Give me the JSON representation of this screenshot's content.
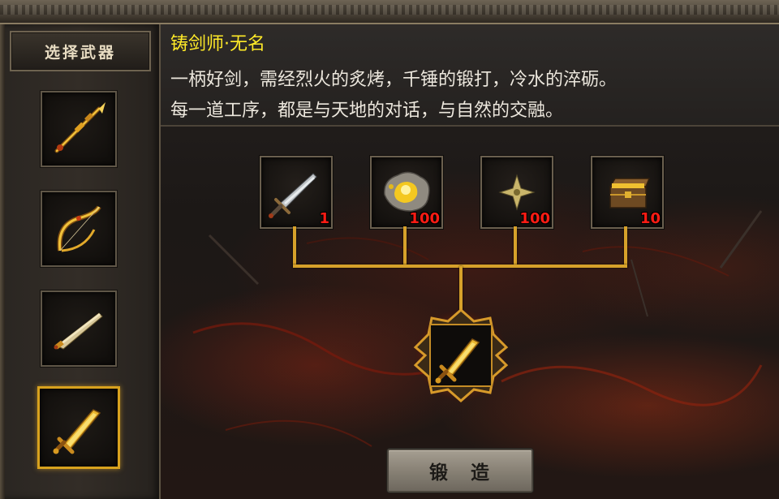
{
  "sidebar": {
    "title": "选择武器",
    "weapons": [
      {
        "icon": "golden-spear-icon",
        "selected": false
      },
      {
        "icon": "golden-bow-icon",
        "selected": false
      },
      {
        "icon": "golden-blade-icon",
        "selected": false
      },
      {
        "icon": "golden-greatsword-icon",
        "selected": true
      }
    ]
  },
  "description": {
    "title": "铸剑师·无名",
    "line1": "一柄好剑，需经烈火的炙烤，千锤的锻打，冷水的淬砺。",
    "line2": "每一道工序，都是与天地的对话，与自然的交融。"
  },
  "materials": [
    {
      "icon": "sword-icon",
      "count": "1"
    },
    {
      "icon": "gold-ore-icon",
      "count": "100"
    },
    {
      "icon": "shuriken-star-icon",
      "count": "100"
    },
    {
      "icon": "treasure-chest-icon",
      "count": "10"
    }
  ],
  "result": {
    "icon": "golden-greatsword-icon"
  },
  "forge_button": {
    "label": "锻 造"
  },
  "colors": {
    "title_yellow": "#ffea28",
    "count_red": "#ff1c14",
    "connector_gold": "#d6a12a",
    "selected_border": "#d8a21e"
  }
}
